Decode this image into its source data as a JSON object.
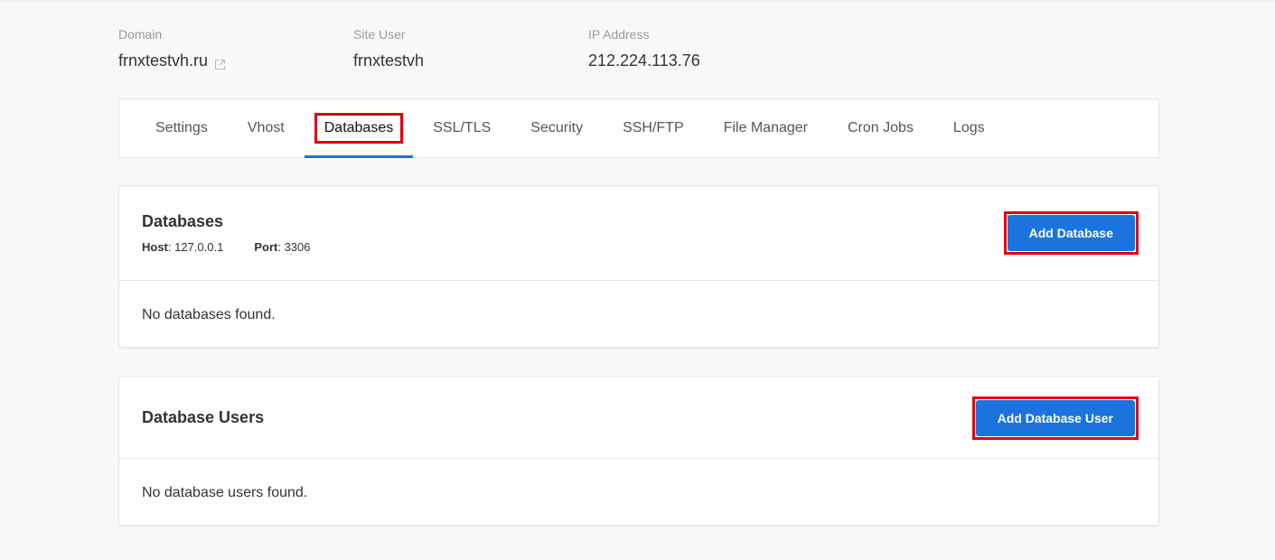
{
  "info": {
    "domain": {
      "label": "Domain",
      "value": "frnxtestvh.ru",
      "icon": "external-link-icon"
    },
    "site_user": {
      "label": "Site User",
      "value": "frnxtestvh"
    },
    "ip_address": {
      "label": "IP Address",
      "value": "212.224.113.76"
    }
  },
  "tabs": [
    {
      "label": "Settings"
    },
    {
      "label": "Vhost"
    },
    {
      "label": "Databases",
      "active": true
    },
    {
      "label": "SSL/TLS"
    },
    {
      "label": "Security"
    },
    {
      "label": "SSH/FTP"
    },
    {
      "label": "File Manager"
    },
    {
      "label": "Cron Jobs"
    },
    {
      "label": "Logs"
    }
  ],
  "databases": {
    "title": "Databases",
    "host_label": "Host",
    "host_value": "127.0.0.1",
    "port_label": "Port",
    "port_value": "3306",
    "add_button": "Add Database",
    "empty_text": "No databases found."
  },
  "database_users": {
    "title": "Database Users",
    "add_button": "Add Database User",
    "empty_text": "No database users found."
  },
  "colors": {
    "accent": "#1b74de",
    "active_tab_underline": "#1976d2",
    "highlight": "#e0000f",
    "background": "#f7f8fa"
  }
}
